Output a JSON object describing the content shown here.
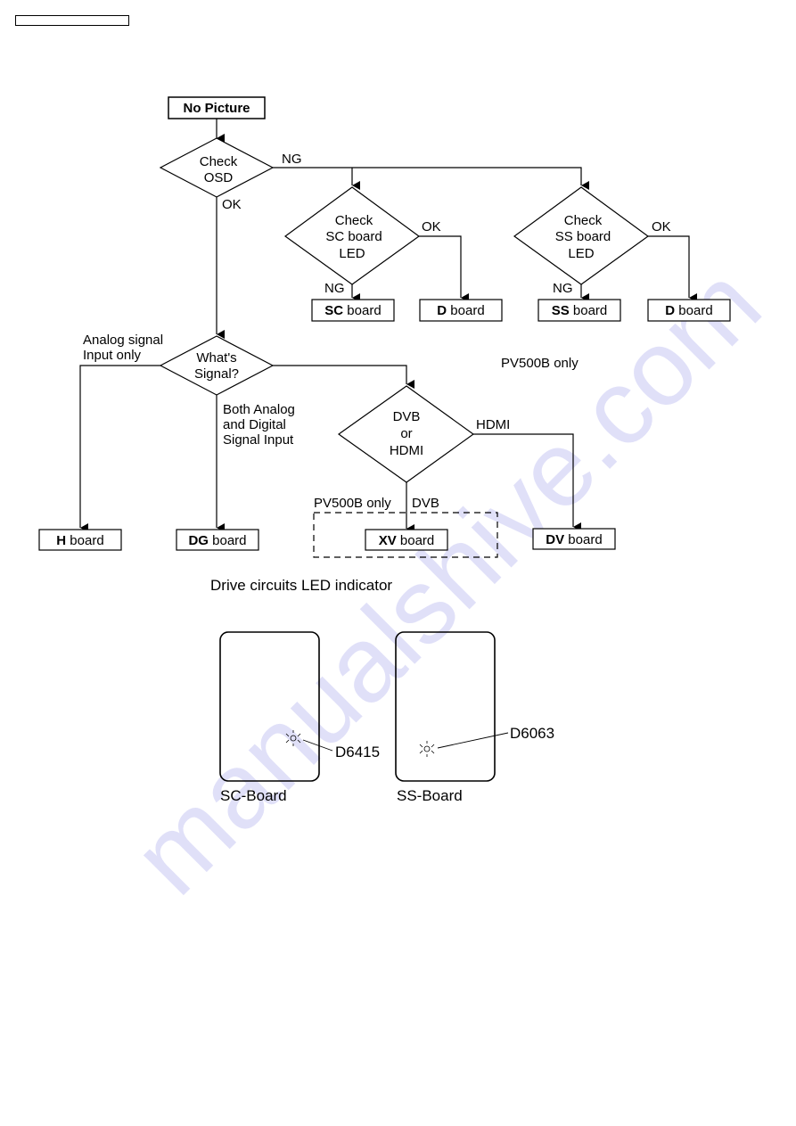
{
  "header": {
    "title_box_text": ""
  },
  "flowchart": {
    "start": {
      "label": "No Picture"
    },
    "check_osd": {
      "lines": [
        "Check",
        "OSD"
      ],
      "ng_label": "NG",
      "ok_label": "OK"
    },
    "check_sc": {
      "lines": [
        "Check",
        "SC board",
        "LED"
      ],
      "ok_label": "OK",
      "ng_label": "NG"
    },
    "check_ss": {
      "lines": [
        "Check",
        "SS board",
        "LED"
      ],
      "ok_label": "OK",
      "ng_label": "NG"
    },
    "sc_board": {
      "bold": "SC",
      "rest": " board"
    },
    "d_board_1": {
      "bold": "D",
      "rest": " board"
    },
    "ss_board": {
      "bold": "SS",
      "rest": " board"
    },
    "d_board_2": {
      "bold": "D",
      "rest": " board"
    },
    "whats_signal": {
      "lines": [
        "What's",
        "Signal?"
      ],
      "left_label": [
        "Analog signal",
        "Input only"
      ],
      "down_label": [
        "Both Analog",
        "and Digital",
        "Signal Input"
      ]
    },
    "pv500b_note": "PV500B only",
    "dvb_hdmi": {
      "lines": [
        "DVB",
        "or",
        "HDMI"
      ],
      "hdmi_label": "HDMI",
      "dvb_label": "DVB"
    },
    "pv500b_dashed_note": "PV500B only",
    "h_board": {
      "bold": "H",
      "rest": " board"
    },
    "dg_board": {
      "bold": "DG",
      "rest": " board"
    },
    "xv_board": {
      "bold": "XV",
      "rest": " board"
    },
    "dv_board": {
      "bold": "DV",
      "rest": " board"
    }
  },
  "led_section": {
    "title": "Drive circuits LED indicator",
    "boards": [
      {
        "name": "SC-Board",
        "led": "D6415"
      },
      {
        "name": "SS-Board",
        "led": "D6063"
      }
    ]
  },
  "watermark": {
    "text": "manualshive.com",
    "color": "#c8c8f4"
  }
}
